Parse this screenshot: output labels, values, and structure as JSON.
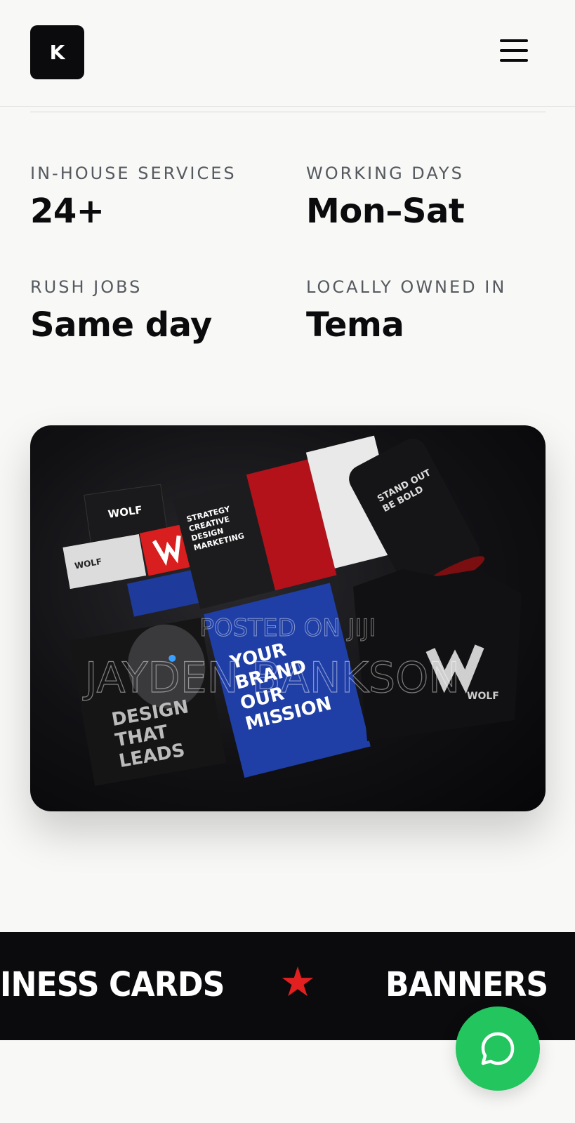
{
  "header": {
    "logo_letter": "K",
    "menu_icon": "hamburger-icon"
  },
  "stats": [
    {
      "label": "IN-HOUSE SERVICES",
      "value": "24+"
    },
    {
      "label": "WORKING DAYS",
      "value": "Mon–Sat"
    },
    {
      "label": "RUSH JOBS",
      "value": "Same day"
    },
    {
      "label": "LOCALLY OWNED IN",
      "value": "Tema"
    }
  ],
  "hero_image": {
    "watermark_top": "POSTED ON JIJI",
    "watermark_name": "JAYDEN BANKSON",
    "mockup_texts": {
      "brand": "WOLF",
      "brochure": "STRATEGY CREATIVE DESIGN MARKETING",
      "tube": "STAND OUT BE BOLD",
      "blue_book": "YOUR BRAND OUR MISSION",
      "poster": "DESIGN THAT LEADS"
    }
  },
  "marquee": {
    "items": [
      "INESS CARDS",
      "BANNERS"
    ],
    "separator_icon": "star-icon",
    "separator_color": "#e32020"
  },
  "whatsapp": {
    "icon": "chat-bubble-icon",
    "color": "#22c55e"
  }
}
